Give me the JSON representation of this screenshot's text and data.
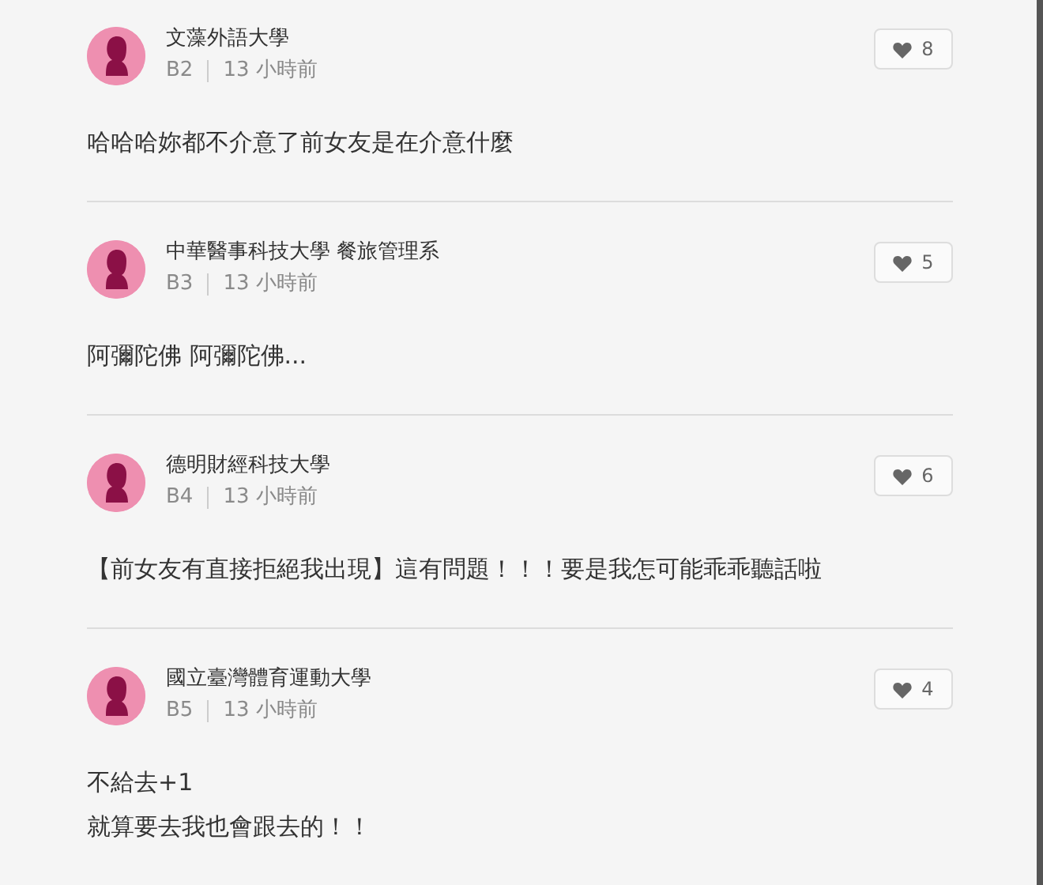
{
  "comments": [
    {
      "author": "文藻外語大學",
      "floor": "B2",
      "time": "13 小時前",
      "likes": "8",
      "body": [
        "哈哈哈妳都不介意了前女友是在介意什麼"
      ]
    },
    {
      "author": "中華醫事科技大學 餐旅管理系",
      "floor": "B3",
      "time": "13 小時前",
      "likes": "5",
      "body": [
        "阿彌陀佛 阿彌陀佛..."
      ]
    },
    {
      "author": "德明財經科技大學",
      "floor": "B4",
      "time": "13 小時前",
      "likes": "6",
      "body": [
        "【前女友有直接拒絕我出現】這有問題！！！要是我怎可能乖乖聽話啦"
      ]
    },
    {
      "author": "國立臺灣體育運動大學",
      "floor": "B5",
      "time": "13 小時前",
      "likes": "4",
      "body": [
        "不給去+1",
        "就算要去我也會跟去的！！"
      ]
    }
  ]
}
